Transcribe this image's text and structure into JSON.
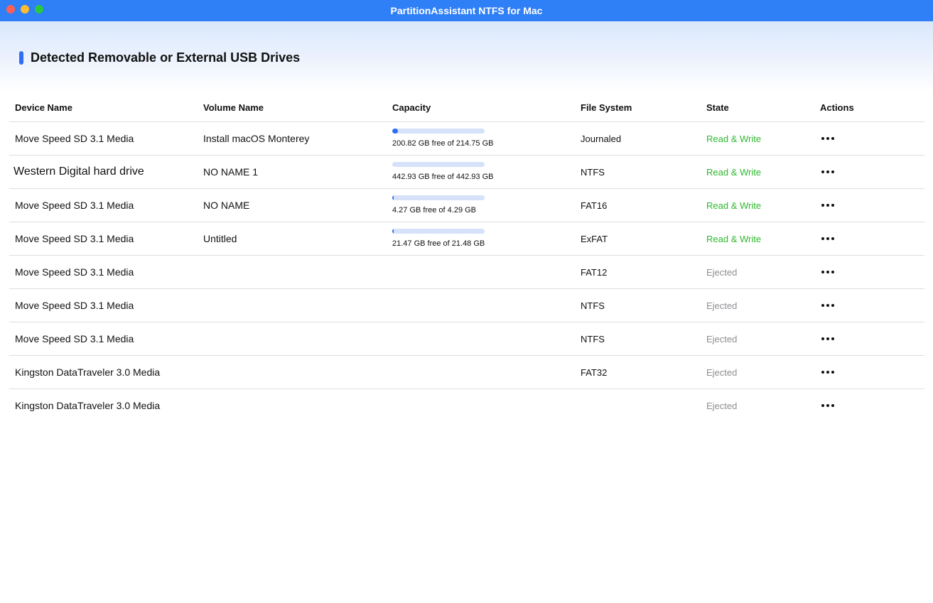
{
  "window": {
    "title": "PartitionAssistant NTFS for Mac"
  },
  "section": {
    "title": "Detected Removable or External USB Drives"
  },
  "colors": {
    "titlebar": "#2f7ff7",
    "accent": "#2f6df6",
    "read_write": "#2eb82e",
    "ejected": "#8e8e93"
  },
  "table": {
    "headers": {
      "device": "Device Name",
      "volume": "Volume Name",
      "capacity": "Capacity",
      "fs": "File System",
      "state": "State",
      "actions": "Actions"
    },
    "rows": [
      {
        "device": "Move Speed SD 3.1 Media",
        "volume": "Install macOS Monterey",
        "capacity_text": "200.82 GB free of 214.75 GB",
        "used_fraction": 0.065,
        "fs": "Journaled",
        "state": "Read & Write",
        "state_type": "rw",
        "actions_icon": "more-horizontal-icon"
      },
      {
        "device": "Western Digital hard drive",
        "volume": "NO NAME 1",
        "capacity_text": "442.93 GB free of 442.93 GB",
        "used_fraction": 0.0,
        "fs": "NTFS",
        "state": "Read & Write",
        "state_type": "rw",
        "actions_icon": "more-horizontal-icon"
      },
      {
        "device": "Move Speed SD 3.1 Media",
        "volume": "NO NAME",
        "capacity_text": "4.27 GB free of 4.29 GB",
        "used_fraction": 0.005,
        "fs": "FAT16",
        "state": "Read & Write",
        "state_type": "rw",
        "actions_icon": "more-horizontal-icon"
      },
      {
        "device": "Move Speed SD 3.1 Media",
        "volume": "Untitled",
        "capacity_text": "21.47 GB free of 21.48 GB",
        "used_fraction": 0.0005,
        "fs": "ExFAT",
        "state": "Read & Write",
        "state_type": "rw",
        "actions_icon": "more-horizontal-icon"
      },
      {
        "device": "Move Speed SD 3.1 Media",
        "volume": "",
        "capacity_text": "",
        "used_fraction": null,
        "fs": "FAT12",
        "state": "Ejected",
        "state_type": "ej",
        "actions_icon": "more-horizontal-icon"
      },
      {
        "device": "Move Speed SD 3.1 Media",
        "volume": "",
        "capacity_text": "",
        "used_fraction": null,
        "fs": "NTFS",
        "state": "Ejected",
        "state_type": "ej",
        "actions_icon": "more-horizontal-icon"
      },
      {
        "device": "Move Speed SD 3.1 Media",
        "volume": "",
        "capacity_text": "",
        "used_fraction": null,
        "fs": "NTFS",
        "state": "Ejected",
        "state_type": "ej",
        "actions_icon": "more-horizontal-icon"
      },
      {
        "device": "Kingston DataTraveler 3.0 Media",
        "volume": "",
        "capacity_text": "",
        "used_fraction": null,
        "fs": "FAT32",
        "state": "Ejected",
        "state_type": "ej",
        "actions_icon": "more-horizontal-icon"
      },
      {
        "device": "Kingston DataTraveler 3.0 Media",
        "volume": "",
        "capacity_text": "",
        "used_fraction": null,
        "fs": "",
        "state": "Ejected",
        "state_type": "ej",
        "actions_icon": "more-horizontal-icon"
      }
    ]
  }
}
